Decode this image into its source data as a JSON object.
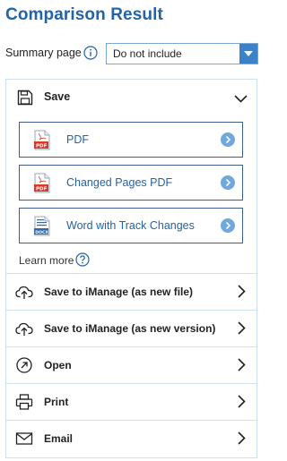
{
  "header": {
    "title": "Comparison Result"
  },
  "summary": {
    "label": "Summary page",
    "selected": "Do not include"
  },
  "save_section": {
    "label": "Save",
    "options": [
      {
        "label": "PDF",
        "icon": "pdf-file-icon"
      },
      {
        "label": "Changed Pages PDF",
        "icon": "pdf-file-icon"
      },
      {
        "label": "Word with Track Changes",
        "icon": "docx-file-icon"
      }
    ],
    "learn_more": "Learn more"
  },
  "actions": [
    {
      "label": "Save to iManage (as new file)",
      "icon": "cloud-upload-icon"
    },
    {
      "label": "Save to iManage (as new version)",
      "icon": "cloud-upload-icon"
    },
    {
      "label": "Open",
      "icon": "open-external-icon"
    },
    {
      "label": "Print",
      "icon": "printer-icon"
    },
    {
      "label": "Email",
      "icon": "envelope-icon"
    }
  ],
  "colors": {
    "accent": "#2363a6",
    "button_blue": "#3b82c9",
    "border": "#cfe0f2",
    "pdf_red": "#d23c2e"
  }
}
